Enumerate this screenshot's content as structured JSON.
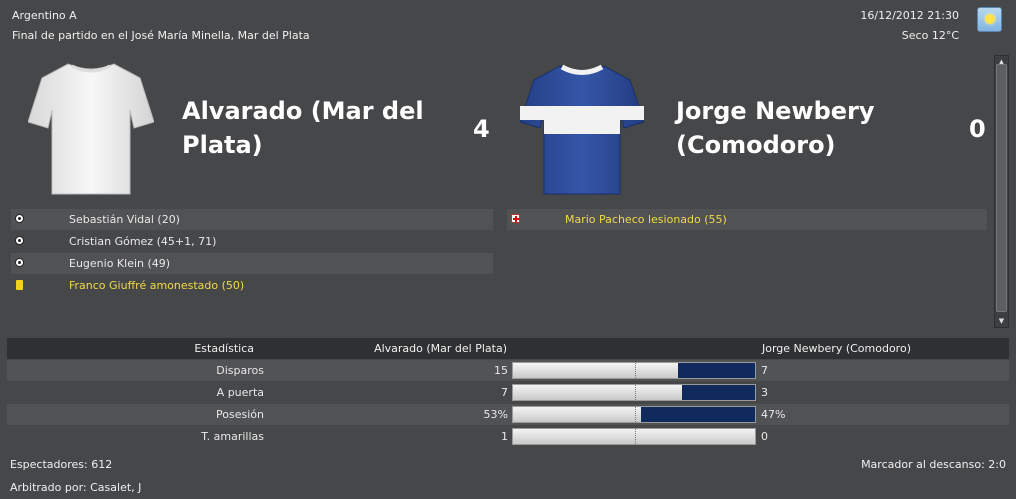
{
  "header": {
    "competition": "Argentino A",
    "venue": "Final de partido en el José María Minella, Mar del Plata",
    "datetime": "16/12/2012 21:30",
    "weather": "Seco 12°C",
    "weather_icon": "sun-icon"
  },
  "home": {
    "name": "Alvarado (Mar del Plata)",
    "score": "4",
    "shirt_colors": {
      "body": "#f2f2f2",
      "trim": "#f2f2f2"
    },
    "events": [
      {
        "type": "goal",
        "icon": "ball-icon",
        "text": "Sebastián Vidal (20)"
      },
      {
        "type": "goal",
        "icon": "ball-icon",
        "text": "Cristian Gómez (45+1, 71)"
      },
      {
        "type": "goal",
        "icon": "ball-icon",
        "text": "Eugenio Klein (49)"
      },
      {
        "type": "booking",
        "icon": "yellow-card-icon",
        "text": "Franco Giuffré amonestado (50)"
      }
    ]
  },
  "away": {
    "name": "Jorge Newbery (Comodoro)",
    "score": "0",
    "shirt_colors": {
      "body": "#2d4c9a",
      "band": "#ffffff"
    },
    "events": [
      {
        "type": "injury",
        "icon": "injury-icon",
        "text": "Mario Pacheco lesionado (55)"
      }
    ]
  },
  "stats": {
    "header_label": "Estadística",
    "header_home": "Alvarado (Mar del Plata)",
    "header_away": "Jorge Newbery (Comodoro)",
    "rows": [
      {
        "label": "Disparos",
        "home": "15",
        "away": "7",
        "away_share": 0.318
      },
      {
        "label": "A puerta",
        "home": "7",
        "away": "3",
        "away_share": 0.3
      },
      {
        "label": "Posesión",
        "home": "53%",
        "away": "47%",
        "away_share": 0.47
      },
      {
        "label": "T. amarillas",
        "home": "1",
        "away": "0",
        "away_share": 0.0
      }
    ]
  },
  "footer": {
    "spectators": "Espectadores: 612",
    "referee": "Arbitrado por: Casalet, J",
    "halftime": "Marcador al descanso: 2:0"
  },
  "colors": {
    "background": "#464749",
    "bar_fill": "#102a5e",
    "highlight_text": "#f1d94a"
  }
}
